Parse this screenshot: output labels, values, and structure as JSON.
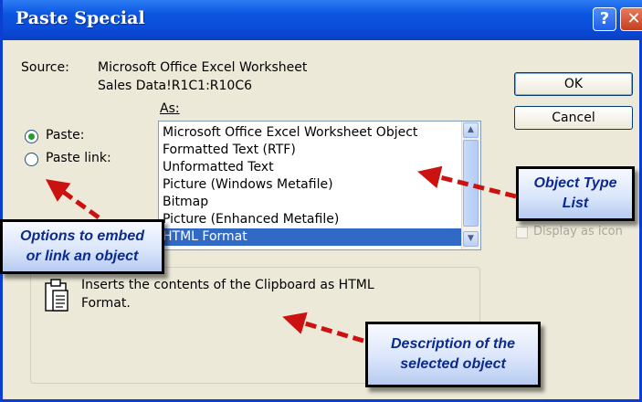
{
  "window": {
    "title": "Paste Special",
    "help_label": "?",
    "close_label": "✕"
  },
  "source": {
    "label": "Source:",
    "line1": "Microsoft Office Excel Worksheet",
    "line2": "Sales Data!R1C1:R10C6"
  },
  "as_label": "As:",
  "options": {
    "paste_label": "Paste:",
    "paste_link_label": "Paste link:",
    "selected": "paste"
  },
  "list": {
    "items": [
      "Microsoft Office Excel Worksheet Object",
      "Formatted Text (RTF)",
      "Unformatted Text",
      "Picture (Windows Metafile)",
      "Bitmap",
      "Picture (Enhanced Metafile)",
      "HTML Format"
    ],
    "selected_index": 6
  },
  "buttons": {
    "ok": "OK",
    "cancel": "Cancel"
  },
  "display_as_icon": {
    "label": "Display as icon",
    "checked": false,
    "enabled": false
  },
  "result": {
    "line1": "Inserts the contents of the Clipboard as HTML",
    "line2": "Format."
  },
  "callouts": {
    "options": {
      "line1": "Options to embed",
      "line2": "or link an object"
    },
    "object_type": {
      "line1": "Object Type",
      "line2": "List"
    },
    "description": {
      "line1": "Description of the",
      "line2": "selected object"
    }
  },
  "colors": {
    "title_bar": "#0a4cd8",
    "selection": "#316ac5",
    "callout_text": "#0a2a8f",
    "arrow": "#cc1111"
  }
}
